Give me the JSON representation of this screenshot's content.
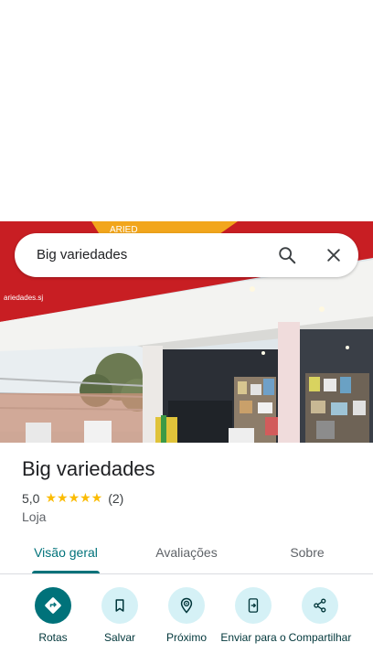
{
  "search": {
    "query": "Big variedades"
  },
  "place": {
    "name": "Big variedades",
    "rating": "5,0",
    "review_count": "(2)",
    "stars": "★★★★★",
    "stars_value": 5,
    "category": "Loja"
  },
  "tabs": [
    {
      "label": "Visão geral",
      "active": true
    },
    {
      "label": "Avaliações",
      "active": false
    },
    {
      "label": "Sobre",
      "active": false
    }
  ],
  "actions": [
    {
      "label": "Rotas",
      "icon": "directions-icon"
    },
    {
      "label": "Salvar",
      "icon": "bookmark-icon"
    },
    {
      "label": "Próximo",
      "icon": "nearby-icon"
    },
    {
      "label": "Enviar para o",
      "icon": "send-to-phone-icon"
    },
    {
      "label": "Compartilhar",
      "icon": "share-icon"
    }
  ],
  "colors": {
    "accent": "#00727a",
    "action_bg": "#d5f1f6",
    "star": "#fbbc04"
  }
}
